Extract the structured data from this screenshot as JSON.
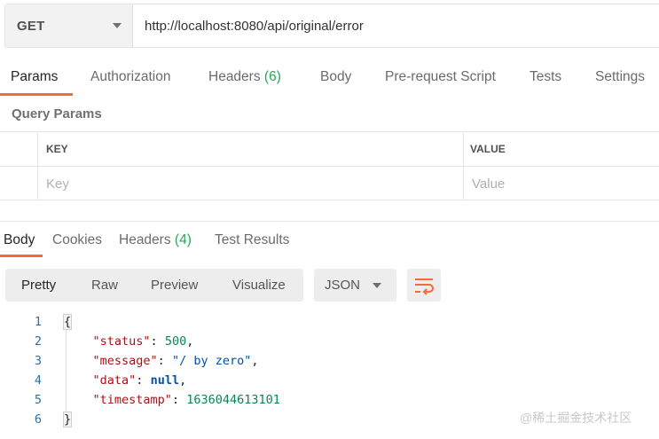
{
  "request": {
    "method": "GET",
    "url": "http://localhost:8080/api/original/error"
  },
  "request_tabs": [
    {
      "label": "Params",
      "count": ""
    },
    {
      "label": "Authorization",
      "count": ""
    },
    {
      "label": "Headers",
      "count": "(6)"
    },
    {
      "label": "Body",
      "count": ""
    },
    {
      "label": "Pre-request Script",
      "count": ""
    },
    {
      "label": "Tests",
      "count": ""
    },
    {
      "label": "Settings",
      "count": ""
    }
  ],
  "query_params": {
    "title": "Query Params",
    "columns": [
      "KEY",
      "VALUE"
    ],
    "key_placeholder": "Key",
    "value_placeholder": "Value"
  },
  "response_tabs": [
    {
      "label": "Body",
      "count": ""
    },
    {
      "label": "Cookies",
      "count": ""
    },
    {
      "label": "Headers",
      "count": "(4)"
    },
    {
      "label": "Test Results",
      "count": ""
    }
  ],
  "view_modes": [
    "Pretty",
    "Raw",
    "Preview",
    "Visualize"
  ],
  "format": "JSON",
  "code": {
    "line_numbers": [
      "1",
      "2",
      "3",
      "4",
      "5",
      "6"
    ],
    "open_brace": "{",
    "close_brace": "}",
    "fields": [
      {
        "key": "\"status\"",
        "value": "500",
        "type": "number"
      },
      {
        "key": "\"message\"",
        "value": "\"/ by zero\"",
        "type": "string"
      },
      {
        "key": "\"data\"",
        "value": "null",
        "type": "null"
      },
      {
        "key": "\"timestamp\"",
        "value": "1636044613101",
        "type": "number"
      }
    ]
  },
  "watermark": "@稀土掘金技术社区",
  "colors": {
    "accent": "#f26b3a",
    "count_green": "#26a65b"
  }
}
